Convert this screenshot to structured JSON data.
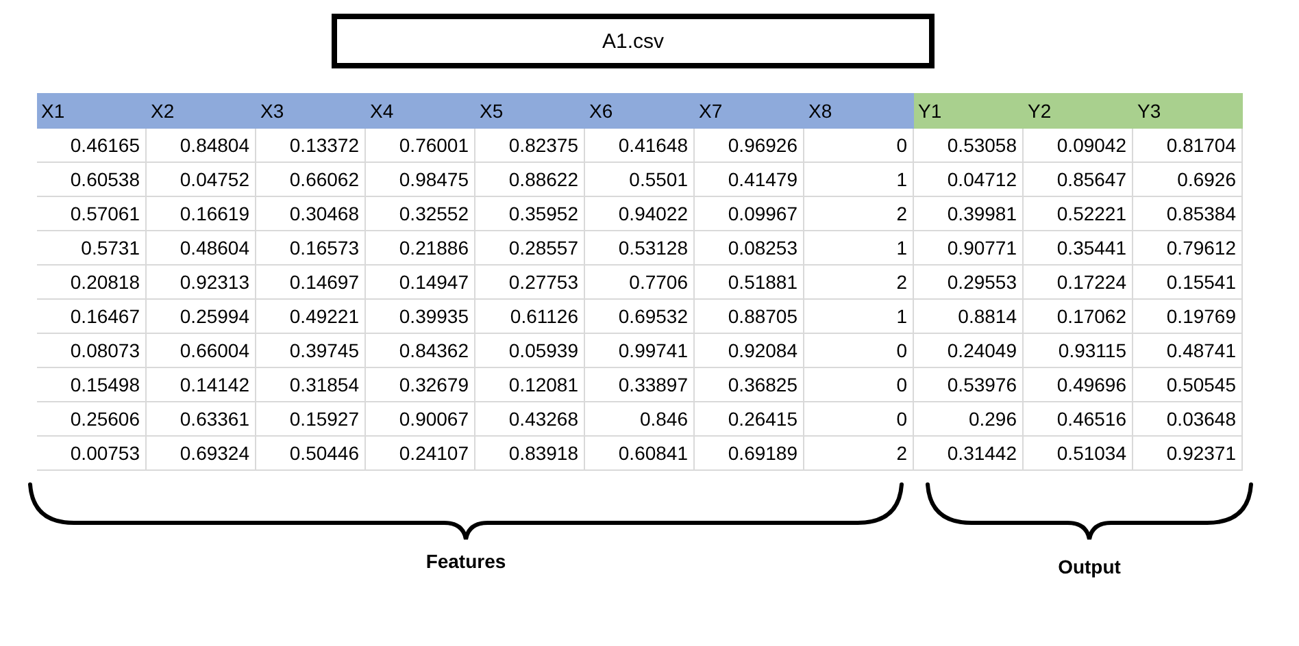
{
  "title": "A1.csv",
  "columns": [
    {
      "label": "X1",
      "color": "#8eaadb"
    },
    {
      "label": "X2",
      "color": "#8eaadb"
    },
    {
      "label": "X3",
      "color": "#8eaadb"
    },
    {
      "label": "X4",
      "color": "#8eaadb"
    },
    {
      "label": "X5",
      "color": "#8eaadb"
    },
    {
      "label": "X6",
      "color": "#8eaadb"
    },
    {
      "label": "X7",
      "color": "#8eaadb"
    },
    {
      "label": "X8",
      "color": "#8eaadb"
    },
    {
      "label": "Y1",
      "color": "#a9d08e"
    },
    {
      "label": "Y2",
      "color": "#a9d08e"
    },
    {
      "label": "Y3",
      "color": "#a9d08e"
    }
  ],
  "rows": [
    [
      "0.46165",
      "0.84804",
      "0.13372",
      "0.76001",
      "0.82375",
      "0.41648",
      "0.96926",
      "0",
      "0.53058",
      "0.09042",
      "0.81704"
    ],
    [
      "0.60538",
      "0.04752",
      "0.66062",
      "0.98475",
      "0.88622",
      "0.5501",
      "0.41479",
      "1",
      "0.04712",
      "0.85647",
      "0.6926"
    ],
    [
      "0.57061",
      "0.16619",
      "0.30468",
      "0.32552",
      "0.35952",
      "0.94022",
      "0.09967",
      "2",
      "0.39981",
      "0.52221",
      "0.85384"
    ],
    [
      "0.5731",
      "0.48604",
      "0.16573",
      "0.21886",
      "0.28557",
      "0.53128",
      "0.08253",
      "1",
      "0.90771",
      "0.35441",
      "0.79612"
    ],
    [
      "0.20818",
      "0.92313",
      "0.14697",
      "0.14947",
      "0.27753",
      "0.7706",
      "0.51881",
      "2",
      "0.29553",
      "0.17224",
      "0.15541"
    ],
    [
      "0.16467",
      "0.25994",
      "0.49221",
      "0.39935",
      "0.61126",
      "0.69532",
      "0.88705",
      "1",
      "0.8814",
      "0.17062",
      "0.19769"
    ],
    [
      "0.08073",
      "0.66004",
      "0.39745",
      "0.84362",
      "0.05939",
      "0.99741",
      "0.92084",
      "0",
      "0.24049",
      "0.93115",
      "0.48741"
    ],
    [
      "0.15498",
      "0.14142",
      "0.31854",
      "0.32679",
      "0.12081",
      "0.33897",
      "0.36825",
      "0",
      "0.53976",
      "0.49696",
      "0.50545"
    ],
    [
      "0.25606",
      "0.63361",
      "0.15927",
      "0.90067",
      "0.43268",
      "0.846",
      "0.26415",
      "0",
      "0.296",
      "0.46516",
      "0.03648"
    ],
    [
      "0.00753",
      "0.69324",
      "0.50446",
      "0.24107",
      "0.83918",
      "0.60841",
      "0.69189",
      "2",
      "0.31442",
      "0.51034",
      "0.92371"
    ]
  ],
  "braces": [
    {
      "label": "Features",
      "kind": "wide"
    },
    {
      "label": "Output",
      "kind": "narrow"
    }
  ]
}
